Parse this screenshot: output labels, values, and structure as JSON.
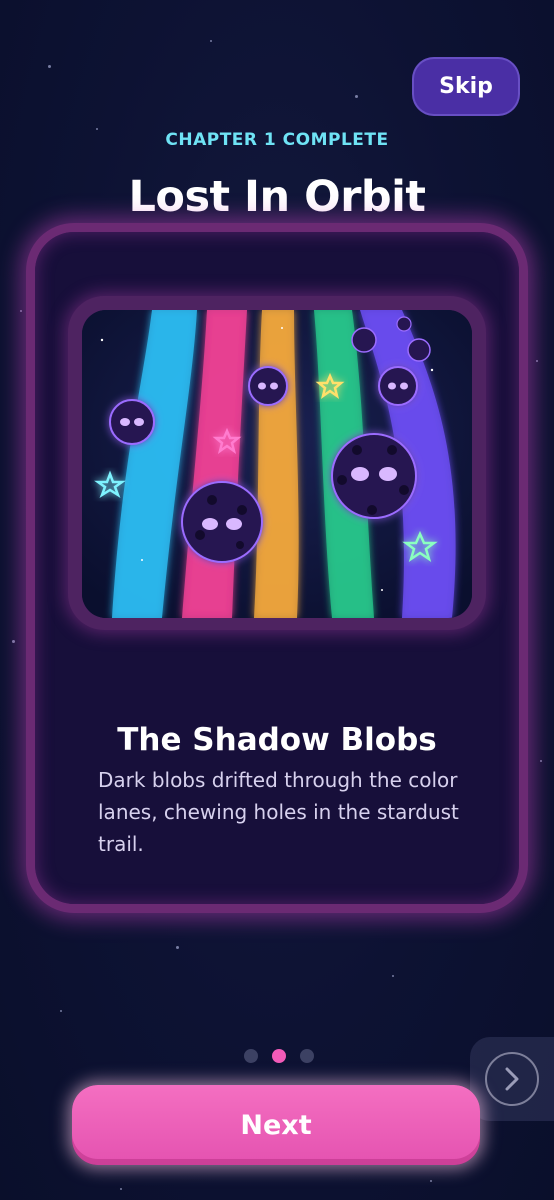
{
  "header": {
    "skip_label": "Skip",
    "chapter_label": "CHAPTER 1 COMPLETE",
    "title": "Lost In Orbit"
  },
  "card": {
    "scene_title": "The Shadow Blobs",
    "scene_text": "Dark blobs drifted through the color lanes, chewing holes in the stardust trail.",
    "art_lanes": [
      "#2bb8ef",
      "#ec3f93",
      "#f3a73c",
      "#27c78b",
      "#6a4cf0"
    ]
  },
  "pagination": {
    "total": 3,
    "current": 2,
    "active_color": "#f25bb8",
    "inactive_color": "#3c4163"
  },
  "footer": {
    "next_label": "Next",
    "next_arrow_icon": "chevron-right-icon"
  },
  "colors": {
    "background": "#0d1233",
    "accent_cyan": "#6fe3f5",
    "skip_purple": "#4a2fa5",
    "next_pink": "#ec5db7",
    "card_glow": "#d24ac8"
  }
}
